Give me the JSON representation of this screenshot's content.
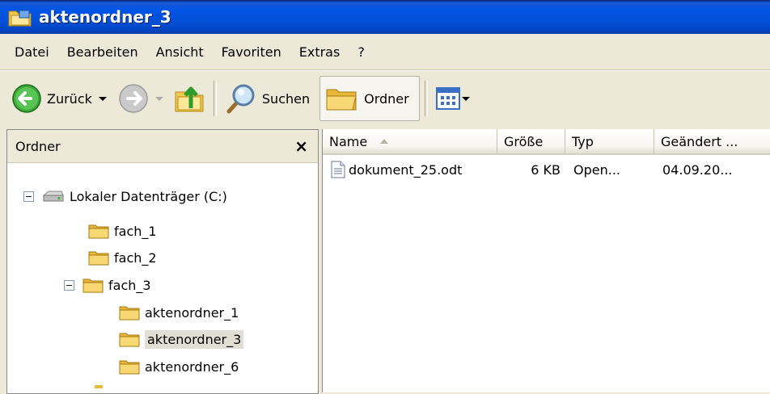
{
  "window": {
    "title": "aktenordner_3"
  },
  "menu": [
    "Datei",
    "Bearbeiten",
    "Ansicht",
    "Favoriten",
    "Extras",
    "?"
  ],
  "toolbar": {
    "back_label": "Zurück",
    "search_label": "Suchen",
    "folders_label": "Ordner"
  },
  "folder_pane": {
    "title": "Ordner",
    "close_symbol": "×"
  },
  "tree": {
    "drive": "Lokaler Datenträger (C:)",
    "fach_1": "fach_1",
    "fach_2": "fach_2",
    "fach_3": "fach_3",
    "akt_1": "aktenordner_1",
    "akt_3": "aktenordner_3",
    "akt_6": "aktenordner_6",
    "collapse_symbol": "−"
  },
  "columns": {
    "name": "Name",
    "size": "Größe",
    "type": "Typ",
    "modified": "Geändert ..."
  },
  "files": [
    {
      "name": "dokument_25.odt",
      "size": "6 KB",
      "type": "Open...",
      "modified": "04.09.20..."
    }
  ],
  "colors": {
    "titlebar": "#0055e5",
    "chrome": "#ece9d8",
    "folder": "#f3c94c",
    "selection": "#e1dfd5"
  }
}
